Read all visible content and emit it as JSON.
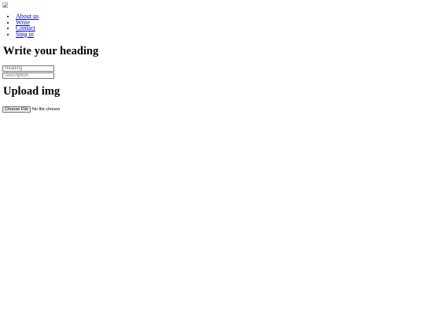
{
  "logo": {
    "icon": "broken-image-icon",
    "alt": ""
  },
  "nav": {
    "items": [
      {
        "label": "About us"
      },
      {
        "label": "Write"
      },
      {
        "label": "Contact"
      },
      {
        "label": "Sing in"
      }
    ]
  },
  "write": {
    "title": "Write your heading",
    "heading_input": {
      "value": "",
      "placeholder": "Heading"
    },
    "description_input": {
      "value": "",
      "placeholder": "Description"
    }
  },
  "upload": {
    "title": "Upload img",
    "button_label": "Choose File",
    "status": "No file chosen"
  }
}
